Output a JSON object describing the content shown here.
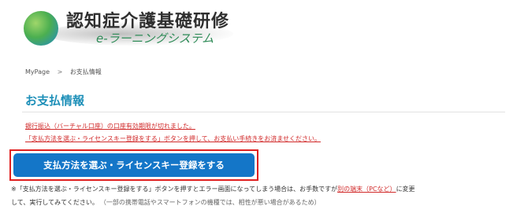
{
  "header": {
    "logo_title": "認知症介護基礎研修",
    "logo_subtitle": "e-ラーニングシステム"
  },
  "breadcrumb": {
    "home": "MyPage",
    "separator": ">",
    "current": "お支払情報"
  },
  "page": {
    "title": "お支払情報"
  },
  "notices": {
    "line1": "銀行振込（バーチャル口座）の口座有効期限が切れました。",
    "line2": "「支払方法を選ぶ・ライセンスキー登録をする」ボタンを押して、お支払い手続きをお済ませください。"
  },
  "cta": {
    "label": "支払方法を選ぶ・ライセンスキー登録をする"
  },
  "note": {
    "part1": "※「支払方法を選ぶ・ライセンスキー登録をする」ボタンを押すとエラー画面になってしまう場合は、お手数ですが",
    "link": "別の端末（PCなど）",
    "part2": "に変更",
    "line2": "して、実行してみてください。",
    "line2_paren": "（一部の携帯電話やスマートフォンの機種では、相性が悪い場合があるため）"
  },
  "colors": {
    "accent_blue": "#1476c8",
    "title_blue": "#1d8fb8",
    "alert_red": "#d12a2a"
  }
}
